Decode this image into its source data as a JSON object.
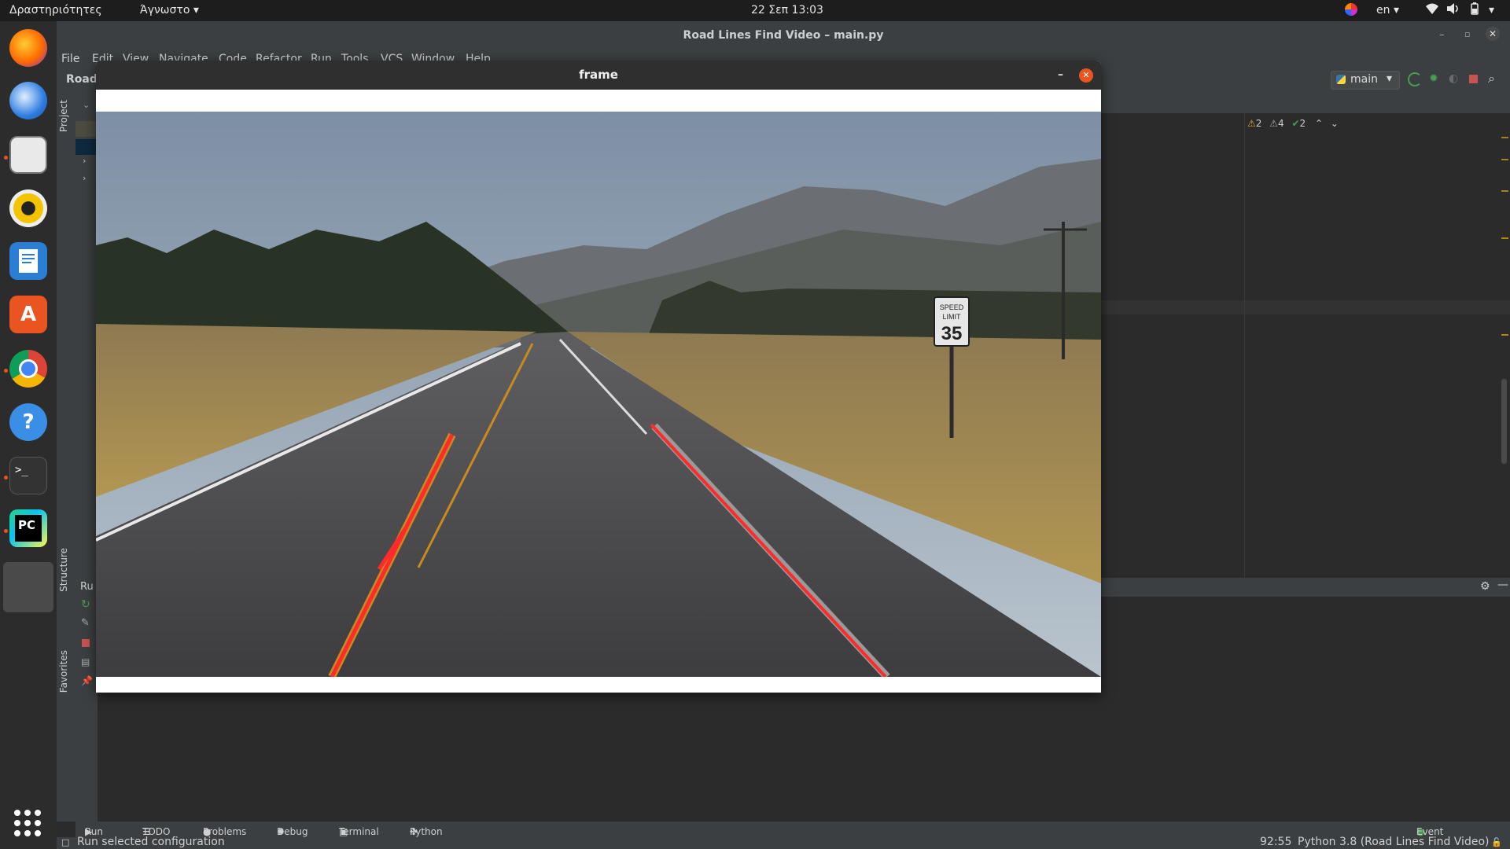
{
  "topbar": {
    "activities": "Δραστηριότητες",
    "app_menu": "Άγνωστο",
    "clock": "22 Σεπ  13:03",
    "language": "en"
  },
  "dock": {
    "items": [
      "firefox-icon",
      "thunderbird-icon",
      "files-icon",
      "rhythmbox-icon",
      "writer-icon",
      "software-icon",
      "chrome-icon",
      "help-icon",
      "terminal-icon",
      "pycharm-icon",
      "unknown-app-icon"
    ],
    "apps_grid": "show-applications-icon"
  },
  "ide": {
    "window_title": "Road Lines Find Video – main.py",
    "project_short": "Road",
    "menu": [
      "File",
      "Edit",
      "View",
      "Navigate",
      "Code",
      "Refactor",
      "Run",
      "Tools",
      "VCS",
      "Window",
      "Help"
    ],
    "run_config": "main",
    "inspections": {
      "warnings": "2",
      "weak_warnings": "4",
      "typos": "2"
    },
    "side_tabs": {
      "project": "Project",
      "structure": "Structure",
      "favorites": "Favorites"
    },
    "run_label": "Ru",
    "bottom_tabs": [
      "Run",
      "TODO",
      "Problems",
      "Debug",
      "Terminal",
      "Python Console"
    ],
    "event_log": "Event Log",
    "status_message": "Run selected configuration",
    "cursor_position": "92:55",
    "interpreter": "Python 3.8 (Road Lines Find Video)"
  },
  "frame_window": {
    "title": "frame",
    "sign_top": "SPEED",
    "sign_mid": "LIMIT",
    "sign_num": "35"
  },
  "colors": {
    "accent_orange": "#e95420",
    "lane_red": "#ff2b2b",
    "ide_bg": "#2b2b2b",
    "ide_panel": "#3c3f41"
  }
}
